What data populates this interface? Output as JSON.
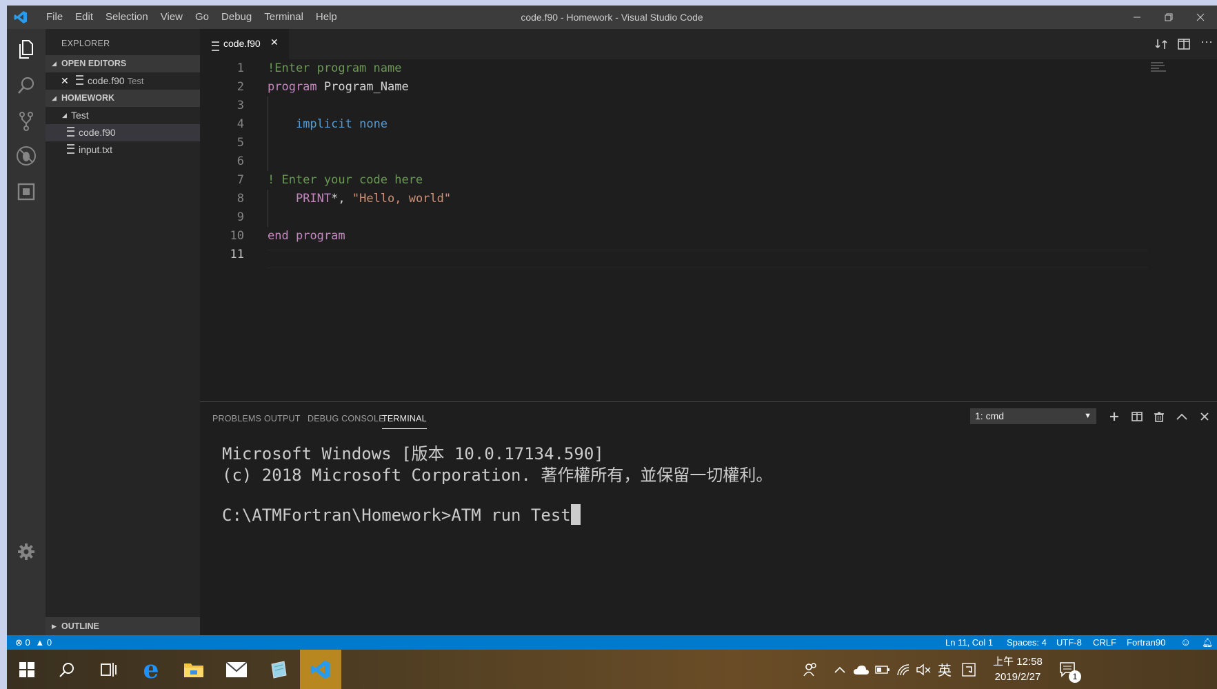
{
  "window": {
    "title": "code.f90 - Homework - Visual Studio Code",
    "menu": [
      "File",
      "Edit",
      "Selection",
      "View",
      "Go",
      "Debug",
      "Terminal",
      "Help"
    ]
  },
  "sidebar": {
    "title": "EXPLORER",
    "open_editors": {
      "label": "OPEN EDITORS",
      "items": [
        {
          "name": "code.f90",
          "folder": "Test"
        }
      ]
    },
    "workspace": {
      "label": "HOMEWORK",
      "folder": "Test",
      "files": [
        "code.f90",
        "input.txt"
      ]
    },
    "outline_label": "OUTLINE"
  },
  "editor": {
    "tab_label": "code.f90",
    "lines": [
      "!Enter program name",
      "program Program_Name",
      "",
      "    implicit none",
      "",
      "",
      "! Enter your code here",
      "    PRINT*, \"Hello, world\"",
      "",
      "end program",
      ""
    ],
    "current_line": 11
  },
  "panel": {
    "tabs": [
      "PROBLEMS",
      "OUTPUT",
      "DEBUG CONSOLE",
      "TERMINAL"
    ],
    "active_tab": "TERMINAL",
    "terminal_select": "1: cmd",
    "terminal_lines": [
      "Microsoft Windows [版本 10.0.17134.590]",
      "(c) 2018 Microsoft Corporation. 著作權所有，並保留一切權利。",
      "",
      "C:\\ATMFortran\\Homework>ATM run Test"
    ]
  },
  "status": {
    "errors": "0",
    "warnings": "0",
    "position": "Ln 11, Col 1",
    "spaces": "Spaces: 4",
    "encoding": "UTF-8",
    "eol": "CRLF",
    "language": "Fortran90"
  },
  "taskbar": {
    "ime": "英",
    "time": "上午 12:58",
    "date": "2019/2/27",
    "notification_count": "1"
  },
  "colors": {
    "comment": "#6a9955",
    "keyword": "#c586c0",
    "blue_keyword": "#569cd6",
    "string": "#ce9178",
    "accent": "#007acc"
  }
}
